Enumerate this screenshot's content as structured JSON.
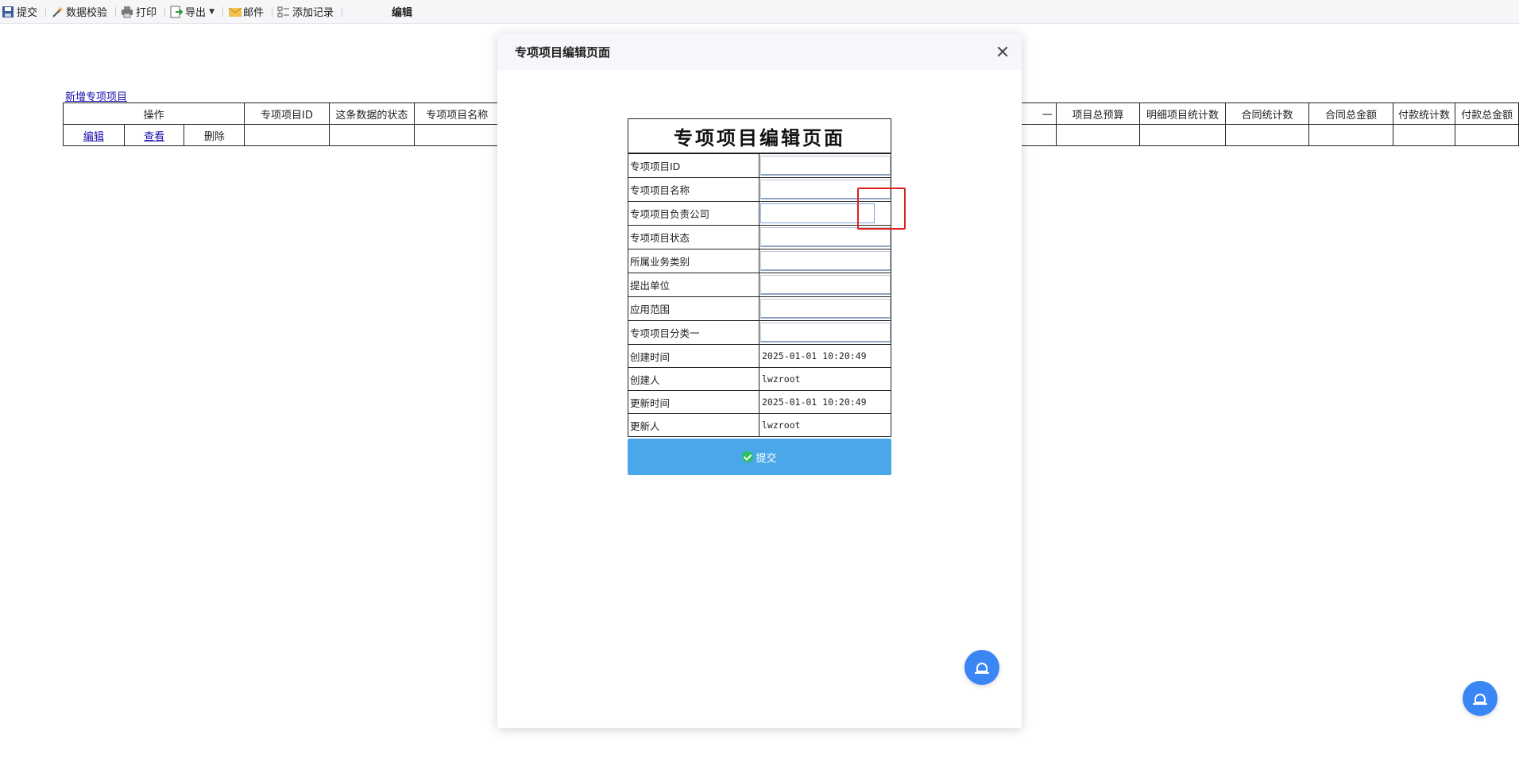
{
  "toolbar": {
    "items": [
      {
        "label": "提交",
        "icon": "save-icon"
      },
      {
        "label": "数据校验",
        "icon": "wand-icon"
      },
      {
        "label": "打印",
        "icon": "printer-icon"
      },
      {
        "label": "导出",
        "icon": "export-icon"
      },
      {
        "label": "邮件",
        "icon": "mail-icon"
      },
      {
        "label": "添加记录",
        "icon": "add-record-icon"
      }
    ],
    "title": "编辑"
  },
  "page": {
    "add_link": "新增专项项目",
    "table": {
      "headers": [
        "操作",
        "专项项目ID",
        "这条数据的状态",
        "专项项目名称",
        "一",
        "项目总预算",
        "明细项目统计数",
        "合同统计数",
        "合同总金额",
        "付款统计数",
        "付款总金额"
      ],
      "row_actions": [
        "编辑",
        "查看",
        "删除"
      ]
    }
  },
  "dialog": {
    "title": "专项项目编辑页面",
    "form_title": "专项项目编辑页面",
    "fields": [
      {
        "label": "专项项目ID",
        "value": ""
      },
      {
        "label": "专项项目名称",
        "value": ""
      },
      {
        "label": "专项项目负责公司",
        "value": ""
      },
      {
        "label": "专项项目状态",
        "value": ""
      },
      {
        "label": "所属业务类别",
        "value": ""
      },
      {
        "label": "提出单位",
        "value": ""
      },
      {
        "label": "应用范围",
        "value": ""
      },
      {
        "label": "专项项目分类一",
        "value": ""
      }
    ],
    "info": [
      {
        "label": "创建时间",
        "value": "2025-01-01 10:20:49"
      },
      {
        "label": "创建人",
        "value": "lwzroot"
      },
      {
        "label": "更新时间",
        "value": "2025-01-01 10:20:49"
      },
      {
        "label": "更新人",
        "value": "lwzroot"
      }
    ],
    "submit_label": "提交"
  },
  "colors": {
    "accent": "#4aa8ea",
    "fab": "#3b86f5",
    "highlight": "#e02020",
    "link": "#1a0dab"
  }
}
